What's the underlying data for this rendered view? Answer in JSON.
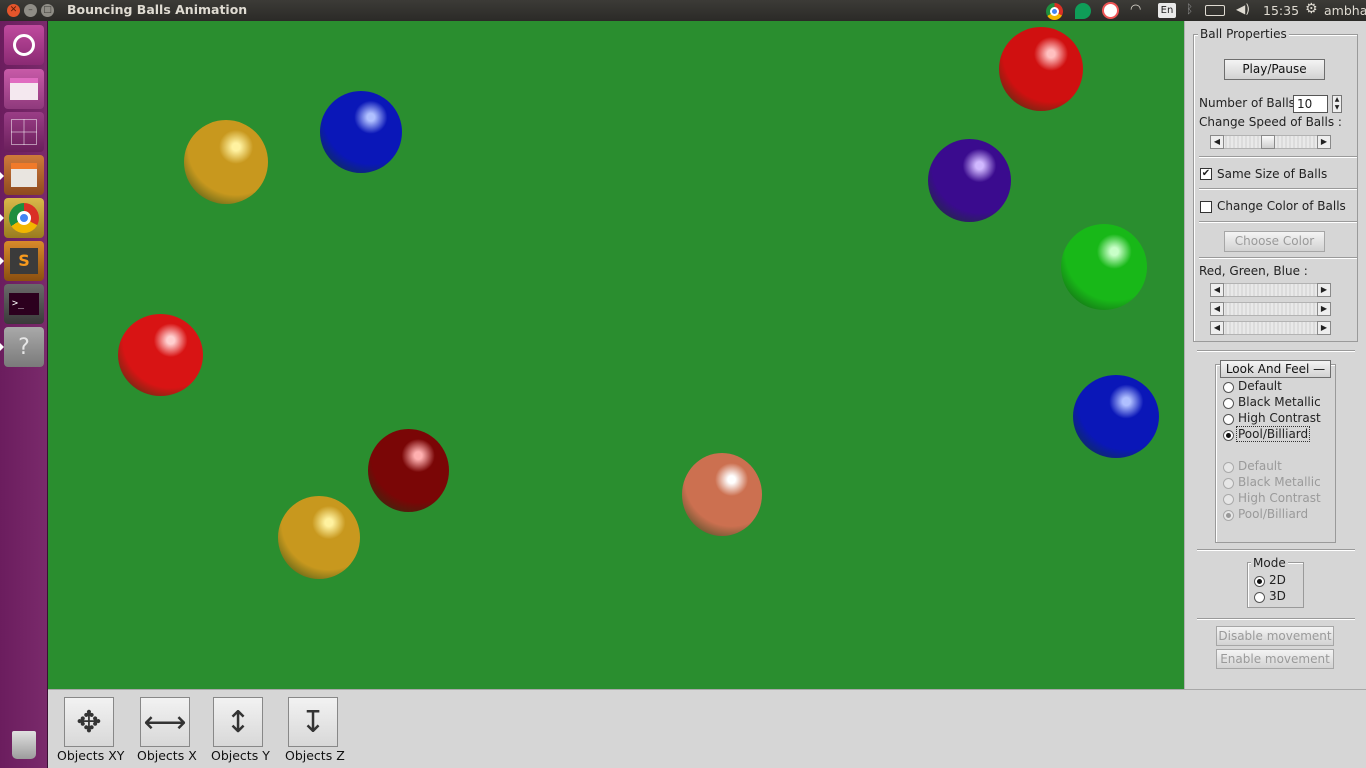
{
  "window": {
    "title": "Bouncing Balls Animation"
  },
  "tray": {
    "lang": "En",
    "clock": "15:35",
    "user": "ambha"
  },
  "launcher": {
    "items": [
      "dash-icon",
      "files-icon",
      "workspace-switcher-icon",
      "file-cabinet-icon",
      "chrome-icon",
      "sublime-text-icon",
      "terminal-icon",
      "help-icon",
      "trash-icon"
    ],
    "sublime_glyph": "S",
    "terminal_glyph": ">_",
    "help_glyph": "?"
  },
  "balls": [
    {
      "color": "#c8981e",
      "highlight": "#fff2a0"
    },
    {
      "color": "#0a17b8",
      "highlight": "#b0c0ff"
    },
    {
      "color": "#d01010",
      "highlight": "#ffc0c0"
    },
    {
      "color": "#3a0b8e",
      "highlight": "#d0b8ff"
    },
    {
      "color": "#18b818",
      "highlight": "#c8ffc8"
    },
    {
      "color": "#d81414",
      "highlight": "#ffd0d0"
    },
    {
      "color": "#0a17b8",
      "highlight": "#b0c0ff"
    },
    {
      "color": "#7a0606",
      "highlight": "#ffb0b0"
    },
    {
      "color": "#cc7050",
      "highlight": "#ffffff"
    },
    {
      "color": "#c8981e",
      "highlight": "#fff2a0"
    }
  ],
  "ball_properties": {
    "group_label": "Ball Properties",
    "play_pause": "Play/Pause",
    "num_balls_label": "Number of Balls:",
    "num_balls_value": "10",
    "speed_label": "Change Speed of Balls :",
    "same_size_label": "Same Size of Balls",
    "same_size_checked": true,
    "change_color_label": "Change Color of Balls",
    "change_color_checked": false,
    "choose_color": "Choose Color",
    "rgb_label": "Red, Green, Blue :"
  },
  "look_and_feel": {
    "button": "Look And Feel —",
    "options_enabled": [
      "Default",
      "Black Metallic",
      "High Contrast",
      "Pool/Billiard"
    ],
    "options_disabled": [
      "Default",
      "Black Metallic",
      "High Contrast",
      "Pool/Billiard"
    ],
    "selected": "Pool/Billiard"
  },
  "mode": {
    "label": "Mode",
    "options": [
      "2D",
      "3D"
    ],
    "selected": "2D"
  },
  "movement": {
    "disable": "Disable movement",
    "enable": "Enable movement"
  },
  "toolbar": {
    "tools": [
      {
        "label": "Objects XY",
        "icon": "move-xy-icon",
        "glyph": "✥"
      },
      {
        "label": "Objects X",
        "icon": "move-x-icon",
        "glyph": "⟷"
      },
      {
        "label": "Objects Y",
        "icon": "move-y-icon",
        "glyph": "↕"
      },
      {
        "label": "Objects Z",
        "icon": "move-z-icon",
        "glyph": "↧"
      }
    ]
  }
}
